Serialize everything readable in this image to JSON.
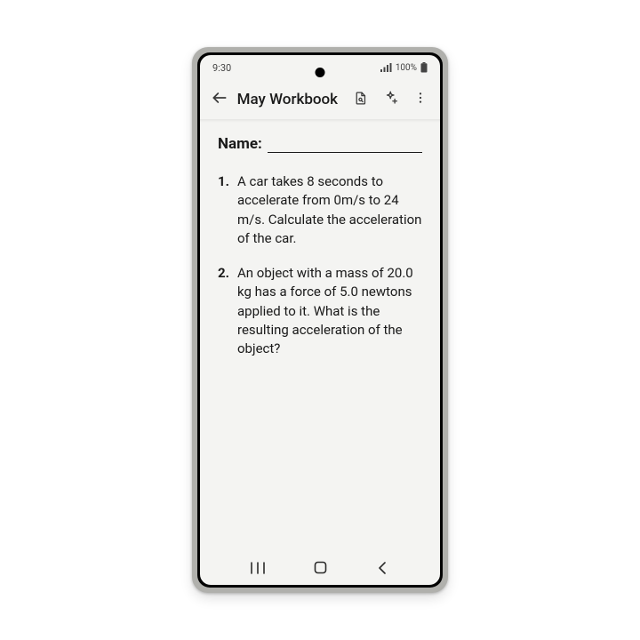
{
  "status": {
    "time": "9:30",
    "battery_text": "100%"
  },
  "appbar": {
    "title": "May Workbook"
  },
  "document": {
    "name_label": "Name:",
    "questions": [
      {
        "num": "1.",
        "text": "A car takes 8 seconds to accelerate from 0m/s to 24 m/s. Calculate the acceleration of the car."
      },
      {
        "num": "2.",
        "text": "An object with a mass of 20.0 kg has a force of 5.0 newtons applied to it. What is the resulting acceleration of the object?"
      }
    ]
  }
}
